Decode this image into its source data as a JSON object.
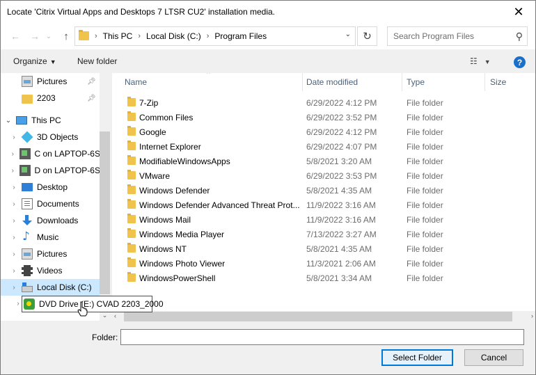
{
  "window": {
    "title": "Locate 'Citrix Virtual Apps and Desktops 7 LTSR CU2' installation media."
  },
  "address": {
    "crumbs": [
      "This PC",
      "Local Disk (C:)",
      "Program Files"
    ],
    "search_placeholder": "Search Program Files"
  },
  "toolbar": {
    "organize_label": "Organize",
    "new_folder_label": "New folder"
  },
  "nav": {
    "quick_access": [
      {
        "label": "Pictures",
        "icon": "pictures-icon",
        "pinned": true
      },
      {
        "label": "2203",
        "icon": "folder-icon",
        "pinned": true
      }
    ],
    "this_pc_label": "This PC",
    "this_pc_children": [
      {
        "label": "3D Objects",
        "icon": "3d-objects-icon"
      },
      {
        "label": "C on LAPTOP-6S",
        "icon": "network-drive-icon"
      },
      {
        "label": "D on LAPTOP-6S",
        "icon": "network-drive-icon"
      },
      {
        "label": "Desktop",
        "icon": "desktop-icon"
      },
      {
        "label": "Documents",
        "icon": "documents-icon"
      },
      {
        "label": "Downloads",
        "icon": "downloads-icon"
      },
      {
        "label": "Music",
        "icon": "music-icon"
      },
      {
        "label": "Pictures",
        "icon": "pictures-icon"
      },
      {
        "label": "Videos",
        "icon": "videos-icon"
      },
      {
        "label": "Local Disk (C:)",
        "icon": "local-disk-icon",
        "selected": true
      },
      {
        "label": "DVD Drive (E:) CVAD 2203_2000",
        "icon": "dvd-drive-icon",
        "hover": true
      }
    ]
  },
  "columns": {
    "name": "Name",
    "date": "Date modified",
    "type": "Type",
    "size": "Size"
  },
  "files": [
    {
      "name": "7-Zip",
      "date": "6/29/2022 4:12 PM",
      "type": "File folder"
    },
    {
      "name": "Common Files",
      "date": "6/29/2022 3:52 PM",
      "type": "File folder"
    },
    {
      "name": "Google",
      "date": "6/29/2022 4:12 PM",
      "type": "File folder"
    },
    {
      "name": "Internet Explorer",
      "date": "6/29/2022 4:07 PM",
      "type": "File folder"
    },
    {
      "name": "ModifiableWindowsApps",
      "date": "5/8/2021 3:20 AM",
      "type": "File folder"
    },
    {
      "name": "VMware",
      "date": "6/29/2022 3:53 PM",
      "type": "File folder"
    },
    {
      "name": "Windows Defender",
      "date": "5/8/2021 4:35 AM",
      "type": "File folder"
    },
    {
      "name": "Windows Defender Advanced Threat Prot...",
      "date": "11/9/2022 3:16 AM",
      "type": "File folder"
    },
    {
      "name": "Windows Mail",
      "date": "11/9/2022 3:16 AM",
      "type": "File folder"
    },
    {
      "name": "Windows Media Player",
      "date": "7/13/2022 3:27 AM",
      "type": "File folder"
    },
    {
      "name": "Windows NT",
      "date": "5/8/2021 4:35 AM",
      "type": "File folder"
    },
    {
      "name": "Windows Photo Viewer",
      "date": "11/3/2021 2:06 AM",
      "type": "File folder"
    },
    {
      "name": "WindowsPowerShell",
      "date": "5/8/2021 3:34 AM",
      "type": "File folder"
    }
  ],
  "footer": {
    "folder_label": "Folder:",
    "folder_value": "",
    "select_label": "Select Folder",
    "cancel_label": "Cancel"
  }
}
